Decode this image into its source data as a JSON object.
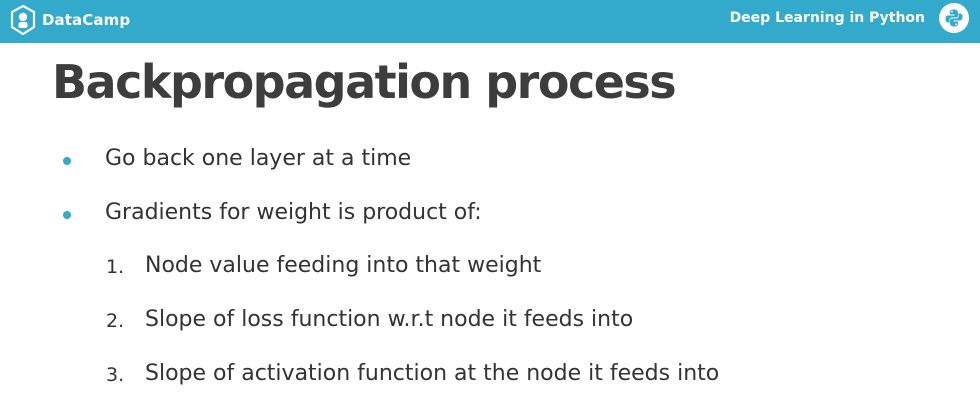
{
  "header": {
    "brand": "DataCamp",
    "brand_icon": "datacamp-logo-icon",
    "course_title": "Deep Learning in Python",
    "course_icon": "python-logo-icon",
    "accent_color": "#33aacc"
  },
  "slide": {
    "title": "Backpropagation process",
    "bullets": [
      "Go back one layer at a time",
      "Gradients for weight is product of:"
    ],
    "numbered": [
      {
        "num": "1.",
        "text": "Node value feeding into that weight"
      },
      {
        "num": "2.",
        "text": "Slope of loss function w.r.t node it feeds into"
      },
      {
        "num": "3.",
        "text": "Slope of activation function at the node it feeds into"
      }
    ]
  }
}
